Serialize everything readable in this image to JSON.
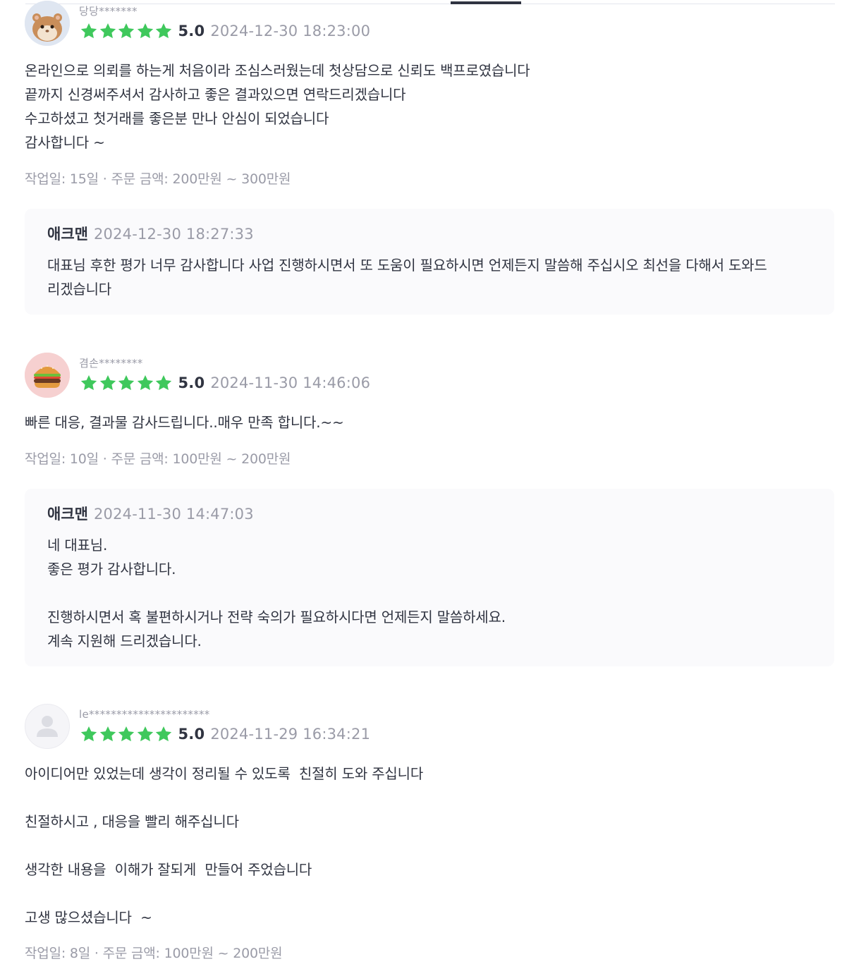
{
  "colors": {
    "star": "#3fc85c",
    "text_primary": "#303441",
    "text_secondary": "#9a9ba7",
    "reply_bg": "#fafafc"
  },
  "reviews": [
    {
      "username": "당당*******",
      "avatar_icon": "hamster-avatar-icon",
      "stars": 5,
      "score": "5.0",
      "date": "2024-12-30 18:23:00",
      "body": "온라인으로 의뢰를 하는게 처음이라 조심스러웠는데 첫상담으로 신뢰도 백프로였습니다\n끝까지 신경써주셔서 감사하고 좋은 결과있으면 연락드리겠습니다\n수고하셨고 첫거래를 좋은분 만나 안심이 되었습니다\n감사합니다 ~",
      "meta": "작업일: 15일 · 주문 금액: 200만원 ~ 300만원",
      "reply": {
        "name": "애크맨",
        "date": "2024-12-30 18:27:33",
        "body": "대표님 후한 평가 너무 감사합니다 사업 진행하시면서 또 도움이 필요하시면 언제든지 말씀해 주십시오 최선을 다해서 도와드\n리겠습니다"
      }
    },
    {
      "username": "겸손********",
      "avatar_icon": "hamburger-avatar-icon",
      "stars": 5,
      "score": "5.0",
      "date": "2024-11-30 14:46:06",
      "body": "빠른 대응, 결과물 감사드립니다..매우 만족 합니다.~~",
      "meta": "작업일: 10일 · 주문 금액: 100만원 ~ 200만원",
      "reply": {
        "name": "애크맨",
        "date": "2024-11-30 14:47:03",
        "body": "네 대표님.\n좋은 평가 감사합니다.\n\n진행하시면서 혹 불편하시거나 전략 숙의가 필요하시다면 언제든지 말씀하세요.\n계속 지원해 드리겠습니다."
      }
    },
    {
      "username": "le**********************",
      "avatar_icon": "default-user-avatar-icon",
      "stars": 5,
      "score": "5.0",
      "date": "2024-11-29 16:34:21",
      "body": "아이디어만 있었는데 생각이 정리될 수 있도록  친절히 도와 주십니다\n\n친절하시고 , 대응을 빨리 해주십니다\n\n생각한 내용을  이해가 잘되게  만들어 주었습니다\n\n고생 많으셨습니다  ~",
      "meta": "작업일: 8일 · 주문 금액: 100만원 ~ 200만원"
    }
  ]
}
